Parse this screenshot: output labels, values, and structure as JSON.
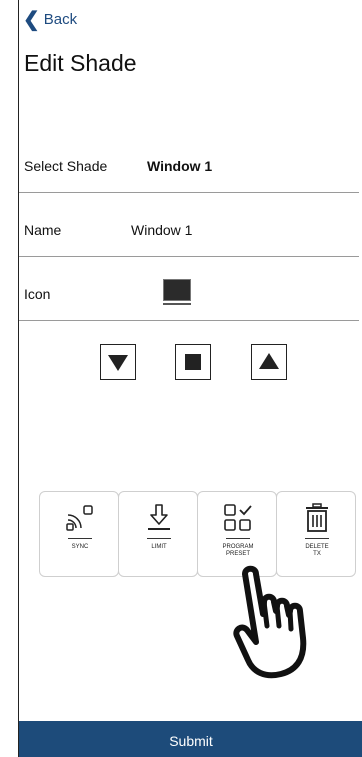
{
  "header": {
    "back_label": "Back",
    "title": "Edit Shade"
  },
  "fields": {
    "select_shade": {
      "label": "Select Shade",
      "value": "Window 1"
    },
    "name": {
      "label": "Name",
      "value": "Window 1"
    },
    "icon": {
      "label": "Icon"
    }
  },
  "controls": [
    "down-icon",
    "stop-icon",
    "up-icon"
  ],
  "tiles": [
    {
      "icon": "sync-icon",
      "line1": "SYNC",
      "line2": ""
    },
    {
      "icon": "limit-icon",
      "line1": "LIMIT",
      "line2": ""
    },
    {
      "icon": "program-preset-icon",
      "line1": "PROGRAM",
      "line2": "PRESET"
    },
    {
      "icon": "delete-icon",
      "line1": "DELETE",
      "line2": "TX"
    }
  ],
  "footer": {
    "submit_label": "Submit"
  },
  "colors": {
    "accent": "#1d4b7a",
    "back_link": "#1e4b80"
  }
}
